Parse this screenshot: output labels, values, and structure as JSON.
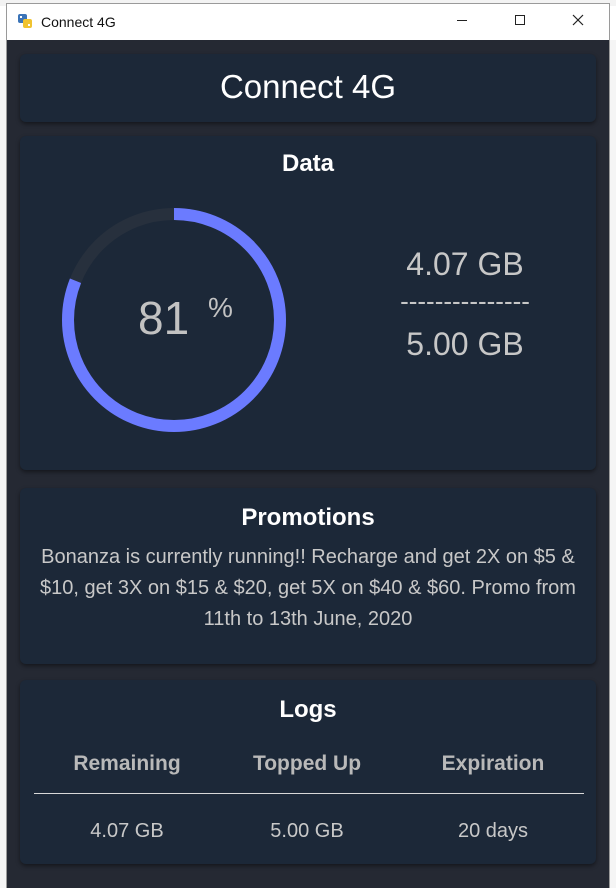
{
  "window": {
    "title": "Connect 4G",
    "icon": "python-app-icon"
  },
  "header": {
    "title": "Connect 4G"
  },
  "data_section": {
    "title": "Data",
    "percent_value": "81",
    "percent_symbol": "%",
    "used": "4.07 GB",
    "separator": "---------------",
    "total": "5.00 GB",
    "progress": 0.81,
    "ring_color": "#6b7bff",
    "track_color": "#27303d"
  },
  "promotions": {
    "title": "Promotions",
    "text": "Bonanza is currently running!! Recharge and get 2X on $5 & $10, get 3X on $15 & $20, get 5X on $40 & $60. Promo from 11th to 13th June, 2020"
  },
  "logs": {
    "title": "Logs",
    "columns": [
      "Remaining",
      "Topped Up",
      "Expiration"
    ],
    "rows": [
      [
        "4.07 GB",
        "5.00 GB",
        "20 days"
      ]
    ]
  },
  "colors": {
    "card_bg": "#1c2838",
    "window_bg": "#252933",
    "text_primary": "#ffffff",
    "text_muted": "#c8c8c8"
  }
}
